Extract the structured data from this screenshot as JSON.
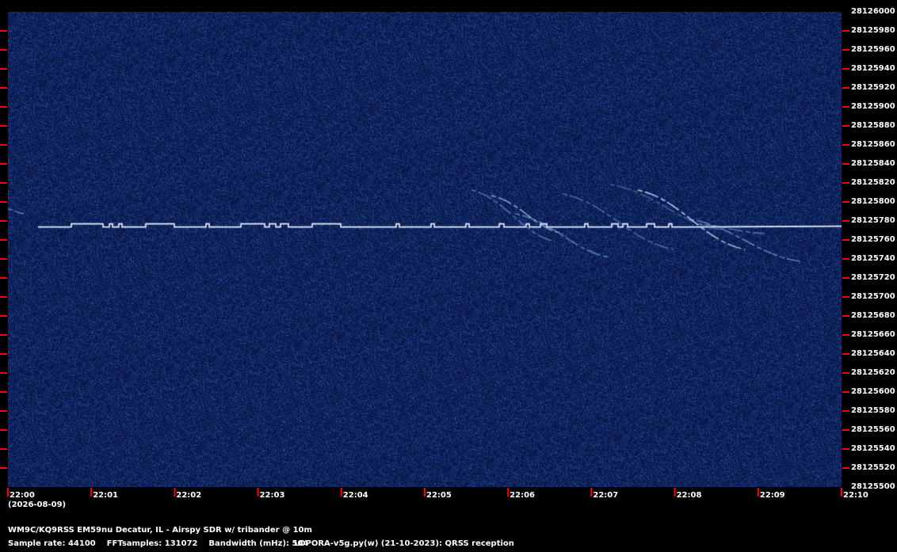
{
  "chart_data": {
    "type": "heatmap",
    "title": "WM9C/KQ9RSS EM59nu Decatur, IL - Airspy SDR w/ tribander @ 10m",
    "xlabel": "",
    "ylabel": "",
    "x_ticks": [
      "22:00",
      "22:01",
      "22:02",
      "22:03",
      "22:04",
      "22:05",
      "22:06",
      "22:07",
      "22:08",
      "22:09",
      "22:10"
    ],
    "x_date": "(2026-08-09)",
    "y_ticks": [
      28126000,
      28125980,
      28125960,
      28125940,
      28125920,
      28125900,
      28125880,
      28125860,
      28125840,
      28125820,
      28125800,
      28125780,
      28125760,
      28125740,
      28125720,
      28125700,
      28125680,
      28125660,
      28125640,
      28125620,
      28125600,
      28125580,
      28125560,
      28125540,
      28125520,
      28125500
    ],
    "ylim": [
      28125500,
      28126000
    ],
    "carrier_hz": 28125774.5,
    "fsk_shift_hz": 2.5,
    "tick_color": "#ff0000",
    "background_color": "#0a1f55"
  },
  "footer": {
    "line1": "WM9C/KQ9RSS EM59nu Decatur, IL - Airspy SDR w/ tribander @ 10m",
    "line2a": "Sample rate: 44100    FFTsamples: 131072    Bandwidth (mHz): 504",
    "line2b": "LOPORA-v5g.py(w) (21-10-2023): QRSS reception"
  }
}
